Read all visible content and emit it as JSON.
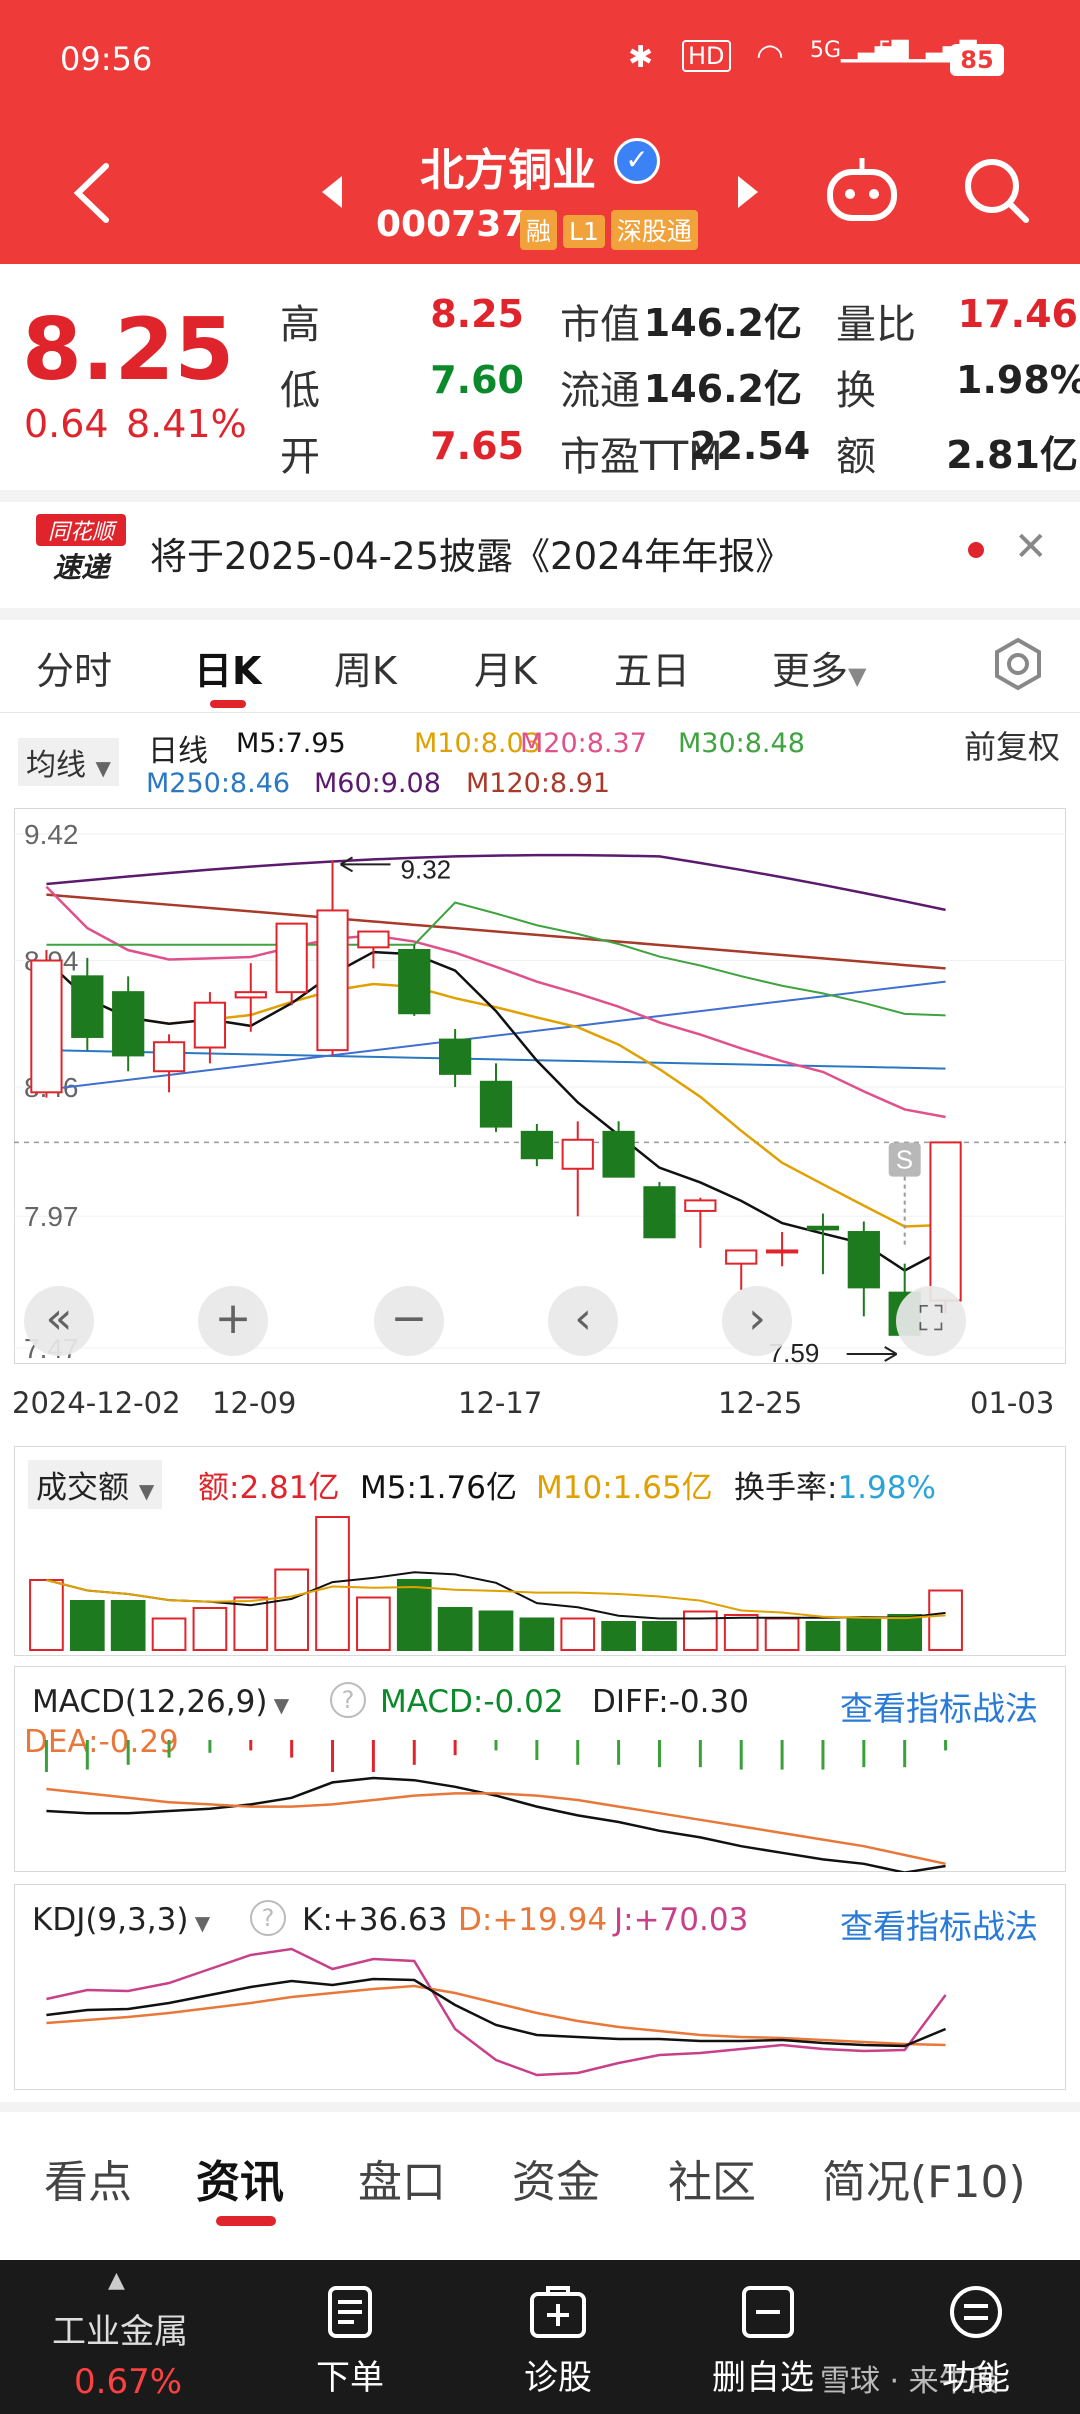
{
  "status_bar": {
    "time": "09:56",
    "battery": "85",
    "hd_label": "HD",
    "net1": "5G",
    "net2": "5G"
  },
  "header": {
    "title": "北方铜业",
    "code": "000737",
    "badges": [
      "融",
      "L1",
      "深股通"
    ]
  },
  "quote": {
    "price": "8.25",
    "change": "0.64",
    "change_pct": "8.41%",
    "rows": [
      [
        {
          "label": "高",
          "value": "8.25"
        },
        {
          "label": "市值",
          "value": "146.2亿"
        },
        {
          "label": "量比",
          "value": "17.46"
        }
      ],
      [
        {
          "label": "低",
          "value": "7.60"
        },
        {
          "label": "流通",
          "value": "146.2亿"
        },
        {
          "label": "换",
          "value": "1.98%"
        }
      ],
      [
        {
          "label": "开",
          "value": "7.65"
        },
        {
          "label": "市盈TTM",
          "value": "22.54"
        },
        {
          "label": "额",
          "value": "2.81亿"
        }
      ]
    ]
  },
  "notice": {
    "logo_top": "同花顺",
    "logo_bottom": "速递",
    "text": "将于2025-04-25披露《2024年年报》"
  },
  "period_tabs": [
    "分时",
    "日K",
    "周K",
    "月K",
    "五日",
    "更多"
  ],
  "active_period": "日K",
  "ma_legend": {
    "selector": "均线",
    "period_label": "日线",
    "right_label": "前复权",
    "items": [
      {
        "text": "M5:7.95",
        "color": "#111111"
      },
      {
        "text": "M10:8.03",
        "color": "#e0a000"
      },
      {
        "text": "M20:8.37",
        "color": "#e0508a"
      },
      {
        "text": "M30:8.48",
        "color": "#3fa33f"
      },
      {
        "text": "M250:8.46",
        "color": "#2a78c2"
      },
      {
        "text": "M60:9.08",
        "color": "#5b1a6e"
      },
      {
        "text": "M120:8.91",
        "color": "#a83a2a"
      }
    ]
  },
  "chart_data": [
    {
      "type": "candlestick",
      "y_ticks": [
        "9.42",
        "8.94",
        "8.46",
        "7.97",
        "7.47"
      ],
      "ylim": [
        7.47,
        9.42
      ],
      "x_labels": [
        "2024-12-02",
        "12-09",
        "12-17",
        "12-25",
        "01-03"
      ],
      "annotations": {
        "high": "9.32",
        "low": "7.59",
        "marker": "S"
      },
      "candles": [
        {
          "o": 8.44,
          "h": 8.98,
          "l": 8.42,
          "c": 8.94
        },
        {
          "o": 8.88,
          "h": 8.95,
          "l": 8.6,
          "c": 8.65
        },
        {
          "o": 8.82,
          "h": 8.88,
          "l": 8.52,
          "c": 8.58
        },
        {
          "o": 8.52,
          "h": 8.66,
          "l": 8.44,
          "c": 8.63
        },
        {
          "o": 8.61,
          "h": 8.82,
          "l": 8.55,
          "c": 8.78
        },
        {
          "o": 8.8,
          "h": 8.93,
          "l": 8.67,
          "c": 8.82
        },
        {
          "o": 8.82,
          "h": 8.92,
          "l": 8.77,
          "c": 9.08
        },
        {
          "o": 8.6,
          "h": 9.32,
          "l": 8.58,
          "c": 9.13
        },
        {
          "o": 8.99,
          "h": 9.05,
          "l": 8.91,
          "c": 9.05
        },
        {
          "o": 8.98,
          "h": 9.0,
          "l": 8.73,
          "c": 8.74
        },
        {
          "o": 8.64,
          "h": 8.68,
          "l": 8.46,
          "c": 8.51
        },
        {
          "o": 8.48,
          "h": 8.55,
          "l": 8.29,
          "c": 8.31
        },
        {
          "o": 8.29,
          "h": 8.32,
          "l": 8.16,
          "c": 8.19
        },
        {
          "o": 8.15,
          "h": 8.33,
          "l": 7.97,
          "c": 8.26
        },
        {
          "o": 8.29,
          "h": 8.33,
          "l": 8.18,
          "c": 8.12
        },
        {
          "o": 8.08,
          "h": 8.1,
          "l": 7.91,
          "c": 7.89
        },
        {
          "o": 7.99,
          "h": 8.04,
          "l": 7.85,
          "c": 8.03
        },
        {
          "o": 7.79,
          "h": 7.81,
          "l": 7.69,
          "c": 7.84
        },
        {
          "o": 7.84,
          "h": 7.91,
          "l": 7.78,
          "c": 7.84
        },
        {
          "o": 7.93,
          "h": 7.98,
          "l": 7.75,
          "c": 7.92
        },
        {
          "o": 7.91,
          "h": 7.95,
          "l": 7.59,
          "c": 7.7
        },
        {
          "o": 7.68,
          "h": 7.79,
          "l": 7.55,
          "c": 7.52
        },
        {
          "o": 7.65,
          "h": 8.25,
          "l": 7.6,
          "c": 8.25
        }
      ]
    },
    {
      "type": "bar",
      "title": "成交额",
      "labels": {
        "amount": "额:2.81亿",
        "m5": "M5:1.76亿",
        "m10": "M10:1.65亿",
        "turnover_label": "换手率:",
        "turnover_value": "1.98%"
      },
      "values": [
        2.0,
        1.4,
        1.4,
        0.9,
        1.2,
        1.5,
        2.3,
        3.8,
        1.5,
        2.0,
        1.2,
        1.1,
        0.9,
        0.9,
        0.8,
        0.8,
        1.1,
        1.0,
        0.9,
        0.8,
        0.9,
        1.0,
        1.7
      ]
    },
    {
      "type": "line",
      "title": "MACD(12,26,9)",
      "labels": {
        "macd": "MACD:-0.02",
        "diff": "DIFF:-0.30",
        "dea": "DEA:-0.29",
        "link": "查看指标战法"
      }
    },
    {
      "type": "line",
      "title": "KDJ(9,3,3)",
      "labels": {
        "k": "K:+36.63",
        "d": "D:+19.94",
        "j": "J:+70.03",
        "link": "查看指标战法"
      }
    }
  ],
  "bottom_tabs": [
    "看点",
    "资讯",
    "盘口",
    "资金",
    "社区",
    "简况(F10)"
  ],
  "active_bottom_tab": "资讯",
  "bottom_nav": {
    "sector": "工业金属",
    "sector_change": "0.67%",
    "items": [
      "下单",
      "诊股",
      "删自选",
      "功能"
    ]
  },
  "watermark": "雪球 · 来牛段",
  "colors": {
    "up": "#e0242c",
    "down": "#1e7a1e",
    "header": "#ef3a3a"
  }
}
